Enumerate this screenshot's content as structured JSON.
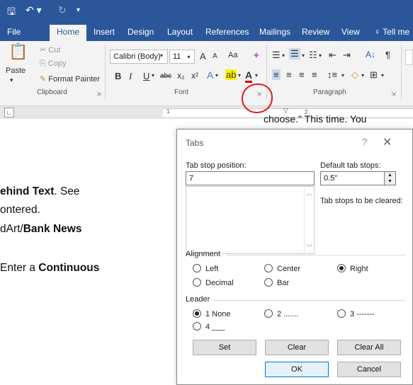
{
  "qat": {
    "save_icon": "save-icon",
    "undo_icon": "undo-icon",
    "redo_icon": "redo-icon"
  },
  "ribbon_tabs": [
    "File",
    "Home",
    "Insert",
    "Design",
    "Layout",
    "References",
    "Mailings",
    "Review",
    "View",
    "Tell me"
  ],
  "clipboard": {
    "paste": "Paste",
    "cut": "Cut",
    "copy": "Copy",
    "format_painter": "Format Painter",
    "group": "Clipboard"
  },
  "font": {
    "name": "Calibri (Body)",
    "size": "11",
    "group": "Font",
    "bold": "B",
    "italic": "I",
    "underline": "U",
    "strike": "abc",
    "subscript": "x₂",
    "superscript": "x²",
    "grow": "A",
    "shrink": "A",
    "case": "Aa"
  },
  "paragraph": {
    "group": "Paragraph",
    "sort": "A↓",
    "pilcrow": "¶"
  },
  "doc": {
    "top_text": "choose.\" This time. You",
    "line1_bold": "ehind Text",
    "line1_rest": ".  See",
    "line2": "ontered.",
    "line3_pre": "dArt/",
    "line3_bold": "Bank News",
    "line4_pre": "Enter a ",
    "line4_bold": "Continuous"
  },
  "dialog": {
    "title": "Tabs",
    "help": "?",
    "close": "✕",
    "tab_stop_label": "Tab stop position:",
    "tab_stop_value": "7",
    "default_label": "Default tab stops:",
    "default_value": "0.5\"",
    "cleared_label": "Tab stops to be cleared:",
    "alignment_label": "Alignment",
    "alignment": {
      "left": "Left",
      "center": "Center",
      "right": "Right",
      "decimal": "Decimal",
      "bar": "Bar",
      "selected": "Right"
    },
    "leader_label": "Leader",
    "leader": {
      "one": "1 None",
      "two": "2 .......",
      "three": "3 -------",
      "four": "4 ___",
      "selected": "1 None"
    },
    "buttons": {
      "set": "Set",
      "clear": "Clear",
      "clear_all": "Clear All",
      "ok": "OK",
      "cancel": "Cancel"
    }
  }
}
